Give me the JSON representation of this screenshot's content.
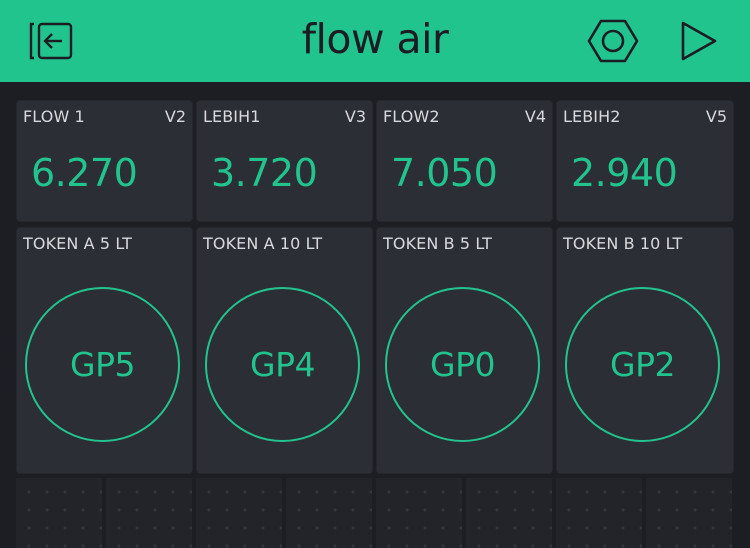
{
  "header": {
    "title": "flow air",
    "accent": "#22c48e",
    "icons": {
      "exit": "exit-icon",
      "settings": "settings-icon",
      "play": "play-icon"
    }
  },
  "value_tiles": [
    {
      "label": "FLOW 1",
      "pin": "V2",
      "value": "6.270"
    },
    {
      "label": "LEBIH1",
      "pin": "V3",
      "value": "3.720"
    },
    {
      "label": "FLOW2",
      "pin": "V4",
      "value": "7.050"
    },
    {
      "label": "LEBIH2",
      "pin": "V5",
      "value": "2.940"
    }
  ],
  "button_tiles": [
    {
      "label": "TOKEN A 5 LT",
      "button": "GP5"
    },
    {
      "label": "TOKEN A 10 LT",
      "button": "GP4"
    },
    {
      "label": "TOKEN B 5 LT",
      "button": "GP0"
    },
    {
      "label": "TOKEN B 10 LT",
      "button": "GP2"
    }
  ],
  "colors": {
    "background": "#1c1e24",
    "tile": "#2c2e35",
    "accent": "#22c48e",
    "label": "#d7d9de"
  }
}
